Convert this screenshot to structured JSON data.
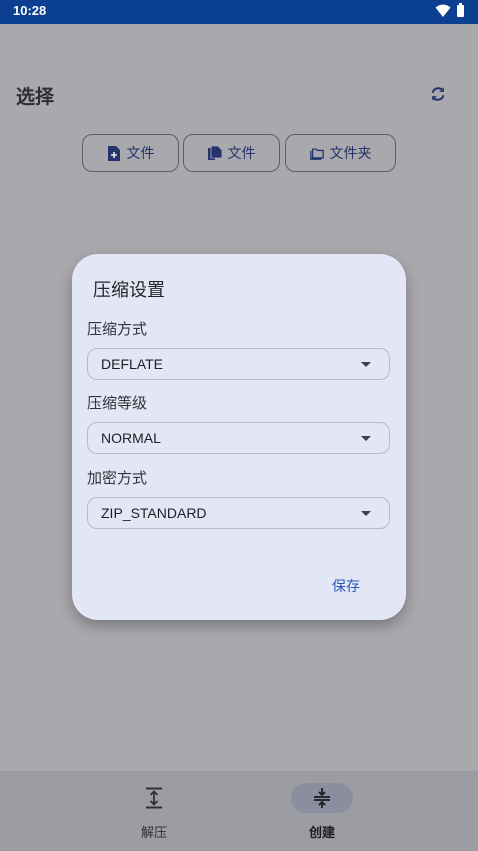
{
  "status_bar": {
    "time": "10:28"
  },
  "header": {
    "title": "选择"
  },
  "file_buttons": [
    {
      "label": "文件",
      "icon": "file-add-icon"
    },
    {
      "label": "文件",
      "icon": "files-icon"
    },
    {
      "label": "文件夹",
      "icon": "folder-icon"
    }
  ],
  "dialog": {
    "title": "压缩设置",
    "compression_method": {
      "label": "压缩方式",
      "value": "DEFLATE"
    },
    "compression_level": {
      "label": "压缩等级",
      "value": "NORMAL"
    },
    "encryption_method": {
      "label": "加密方式",
      "value": "ZIP_STANDARD"
    },
    "save_label": "保存"
  },
  "bottom_nav": {
    "items": [
      {
        "label": "解压",
        "icon": "extract-icon",
        "active": false
      },
      {
        "label": "创建",
        "icon": "compress-icon",
        "active": true
      }
    ]
  },
  "colors": {
    "status_bar": "#0b3f91",
    "accent": "#2a57b6",
    "dialog_bg": "#e3e6f5",
    "scrim_bg": "#a9a8ac"
  }
}
